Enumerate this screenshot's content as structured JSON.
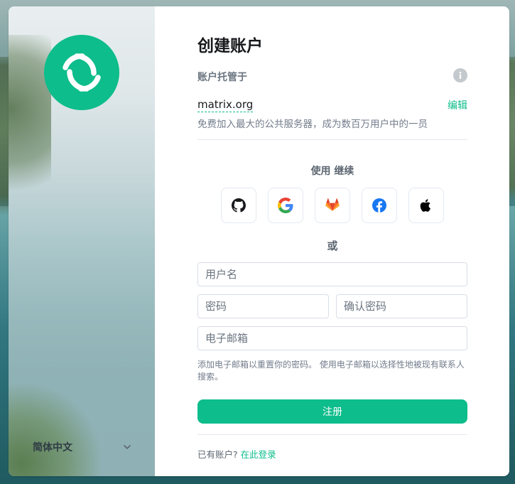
{
  "colors": {
    "accent": "#0dbd8b",
    "title": "#17191c",
    "muted": "#737d8c",
    "border": "#d8dee6"
  },
  "sidebar": {
    "language": {
      "label": "简体中文",
      "icon": "chevron-down-icon"
    },
    "logo_icon": "element-logo-icon"
  },
  "header": {
    "title": "创建账户"
  },
  "server": {
    "hosted_label": "账户托管于",
    "info_icon": "info-icon",
    "name": "matrix.org",
    "edit_label": "编辑",
    "description": "免费加入最大的公共服务器，成为数百万用户中的一员"
  },
  "sso": {
    "continue_label": "使用 继续",
    "providers": [
      {
        "name": "GitHub",
        "icon": "github-icon"
      },
      {
        "name": "Google",
        "icon": "google-icon"
      },
      {
        "name": "GitLab",
        "icon": "gitlab-icon"
      },
      {
        "name": "Facebook",
        "icon": "facebook-icon"
      },
      {
        "name": "Apple",
        "icon": "apple-icon"
      }
    ]
  },
  "or_label": "或",
  "form": {
    "username_placeholder": "用户名",
    "password_placeholder": "密码",
    "confirm_password_placeholder": "确认密码",
    "email_placeholder": "电子邮箱",
    "email_hint": "添加电子邮箱以重置你的密码。 使用电子邮箱以选择性地被现有联系人搜索。",
    "register_label": "注册"
  },
  "footer": {
    "have_account": "已有账户?",
    "signin_link": "在此登录"
  }
}
